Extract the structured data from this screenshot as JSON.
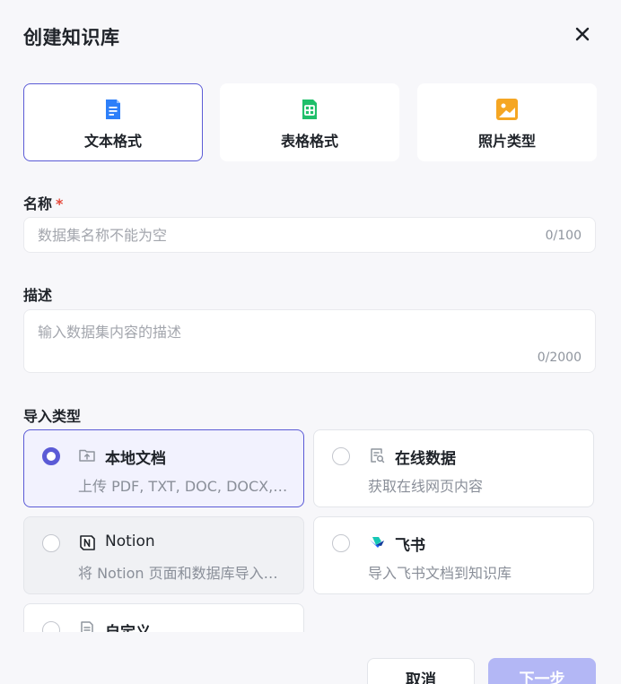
{
  "dialog": {
    "title": "创建知识库"
  },
  "format_tabs": [
    {
      "label": "文本格式",
      "icon": "document-icon",
      "color": "#2d7ff9"
    },
    {
      "label": "表格格式",
      "icon": "table-icon",
      "color": "#1fbf6a"
    },
    {
      "label": "照片类型",
      "icon": "image-icon",
      "color": "#f5a623"
    }
  ],
  "name_field": {
    "label": "名称",
    "required_mark": "*",
    "placeholder": "数据集名称不能为空",
    "value": "",
    "counter": "0/100"
  },
  "desc_field": {
    "label": "描述",
    "placeholder": "输入数据集内容的描述",
    "value": "",
    "counter": "0/2000"
  },
  "import": {
    "label": "导入类型",
    "options": [
      {
        "title": "本地文档",
        "desc": "上传 PDF, TXT, DOC, DOCX, MD 格式的本地文件",
        "selected": true
      },
      {
        "title": "在线数据",
        "desc": "获取在线网页内容",
        "selected": false
      },
      {
        "title": "Notion",
        "desc": "将 Notion 页面和数据库导入知识库",
        "selected": false
      },
      {
        "title": "飞书",
        "desc": "导入飞书文档到知识库",
        "selected": false
      },
      {
        "title": "自定义",
        "desc": "",
        "selected": false
      }
    ]
  },
  "footer": {
    "cancel_label": "取消",
    "next_label": "下一步"
  },
  "colors": {
    "accent": "#5b5bd6",
    "next_disabled": "#b3b7f5"
  }
}
